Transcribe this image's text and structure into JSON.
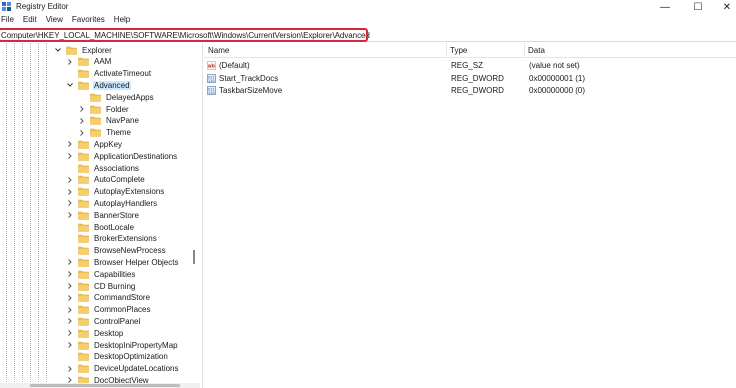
{
  "window": {
    "title": "Registry Editor",
    "minimize": "—",
    "maximize": "☐",
    "close": "✕"
  },
  "menu": [
    "File",
    "Edit",
    "View",
    "Favorites",
    "Help"
  ],
  "address": "Computer\\HKEY_LOCAL_MACHINE\\SOFTWARE\\Microsoft\\Windows\\CurrentVersion\\Explorer\\Advanced",
  "colors": {
    "folder": "#f1c04f",
    "selection": "#cce8ff",
    "highlight": "#d62839"
  },
  "tree": [
    {
      "label": "Explorer",
      "level": 0,
      "chevron": "down"
    },
    {
      "label": "AAM",
      "level": 1,
      "chevron": "right"
    },
    {
      "label": "ActivateTimeout",
      "level": 1,
      "chevron": "none"
    },
    {
      "label": "Advanced",
      "level": 1,
      "chevron": "down",
      "selected": true
    },
    {
      "label": "DelayedApps",
      "level": 2,
      "chevron": "none"
    },
    {
      "label": "Folder",
      "level": 2,
      "chevron": "right"
    },
    {
      "label": "NavPane",
      "level": 2,
      "chevron": "right"
    },
    {
      "label": "Theme",
      "level": 2,
      "chevron": "right"
    },
    {
      "label": "AppKey",
      "level": 1,
      "chevron": "right"
    },
    {
      "label": "ApplicationDestinations",
      "level": 1,
      "chevron": "right"
    },
    {
      "label": "Associations",
      "level": 1,
      "chevron": "none"
    },
    {
      "label": "AutoComplete",
      "level": 1,
      "chevron": "right"
    },
    {
      "label": "AutoplayExtensions",
      "level": 1,
      "chevron": "right"
    },
    {
      "label": "AutoplayHandlers",
      "level": 1,
      "chevron": "right"
    },
    {
      "label": "BannerStore",
      "level": 1,
      "chevron": "right"
    },
    {
      "label": "BootLocale",
      "level": 1,
      "chevron": "none"
    },
    {
      "label": "BrokerExtensions",
      "level": 1,
      "chevron": "none"
    },
    {
      "label": "BrowseNewProcess",
      "level": 1,
      "chevron": "none"
    },
    {
      "label": "Browser Helper Objects",
      "level": 1,
      "chevron": "right"
    },
    {
      "label": "Capabilities",
      "level": 1,
      "chevron": "right"
    },
    {
      "label": "CD Burning",
      "level": 1,
      "chevron": "right"
    },
    {
      "label": "CommandStore",
      "level": 1,
      "chevron": "right"
    },
    {
      "label": "CommonPlaces",
      "level": 1,
      "chevron": "right"
    },
    {
      "label": "ControlPanel",
      "level": 1,
      "chevron": "right"
    },
    {
      "label": "Desktop",
      "level": 1,
      "chevron": "right"
    },
    {
      "label": "DesktopIniPropertyMap",
      "level": 1,
      "chevron": "right"
    },
    {
      "label": "DesktopOptimization",
      "level": 1,
      "chevron": "none"
    },
    {
      "label": "DeviceUpdateLocations",
      "level": 1,
      "chevron": "right"
    },
    {
      "label": "DocObjectView",
      "level": 1,
      "chevron": "right"
    }
  ],
  "list": {
    "columns": [
      "Name",
      "Type",
      "Data"
    ],
    "rows": [
      {
        "icon": "string-value-icon",
        "name": "(Default)",
        "type": "REG_SZ",
        "data": "(value not set)"
      },
      {
        "icon": "dword-value-icon",
        "name": "Start_TrackDocs",
        "type": "REG_DWORD",
        "data": "0x00000001 (1)"
      },
      {
        "icon": "dword-value-icon",
        "name": "TaskbarSizeMove",
        "type": "REG_DWORD",
        "data": "0x00000000 (0)"
      }
    ]
  }
}
